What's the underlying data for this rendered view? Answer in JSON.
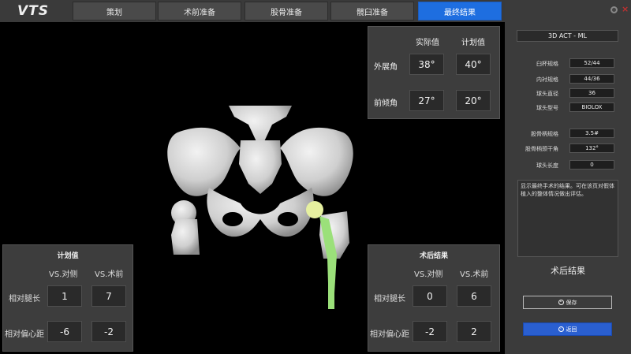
{
  "app": {
    "logo": "VTS"
  },
  "tabs": [
    {
      "label": "策划",
      "active": false
    },
    {
      "label": "术前准备",
      "active": false
    },
    {
      "label": "股骨准备",
      "active": false
    },
    {
      "label": "髋臼准备",
      "active": false
    },
    {
      "label": "最终结果",
      "active": true
    }
  ],
  "angles": {
    "col_actual": "实际值",
    "col_plan": "计划值",
    "rows": [
      {
        "label": "外展角",
        "actual": "38°",
        "plan": "40°"
      },
      {
        "label": "前倾角",
        "actual": "27°",
        "plan": "20°"
      }
    ]
  },
  "plan_panel": {
    "title": "计划值",
    "col_contra": "VS.对侧",
    "col_preop": "VS.术前",
    "rows": [
      {
        "label": "相对腿长",
        "contra": "1",
        "preop": "7"
      },
      {
        "label": "相对偏心距",
        "contra": "-6",
        "preop": "-2"
      }
    ]
  },
  "postop_panel": {
    "title": "术后结果",
    "col_contra": "VS.对侧",
    "col_preop": "VS.术前",
    "rows": [
      {
        "label": "相对腿长",
        "contra": "0",
        "preop": "6"
      },
      {
        "label": "相对偏心距",
        "contra": "-2",
        "preop": "2"
      }
    ]
  },
  "sidebar": {
    "implant": "3D ACT - ML",
    "specs1": [
      {
        "label": "臼杯规格",
        "value": "52/44"
      },
      {
        "label": "内衬规格",
        "value": "44/36"
      },
      {
        "label": "球头直径",
        "value": "36"
      },
      {
        "label": "球头型号",
        "value": "BIOLOX"
      }
    ],
    "specs2": [
      {
        "label": "股骨柄规格",
        "value": "3.5#"
      },
      {
        "label": "股骨柄颈干角",
        "value": "132°"
      },
      {
        "label": "球头长度",
        "value": "0"
      }
    ],
    "description": "显示最终手术的结果。可在该页对假体植入的整体情况做出评估。",
    "result_label": "术后结果",
    "save_label": "保存",
    "back_label": "返回"
  },
  "colors": {
    "accent": "#1e6ee0",
    "implant_green": "#9be07a",
    "bone": "#d9d9d9"
  }
}
